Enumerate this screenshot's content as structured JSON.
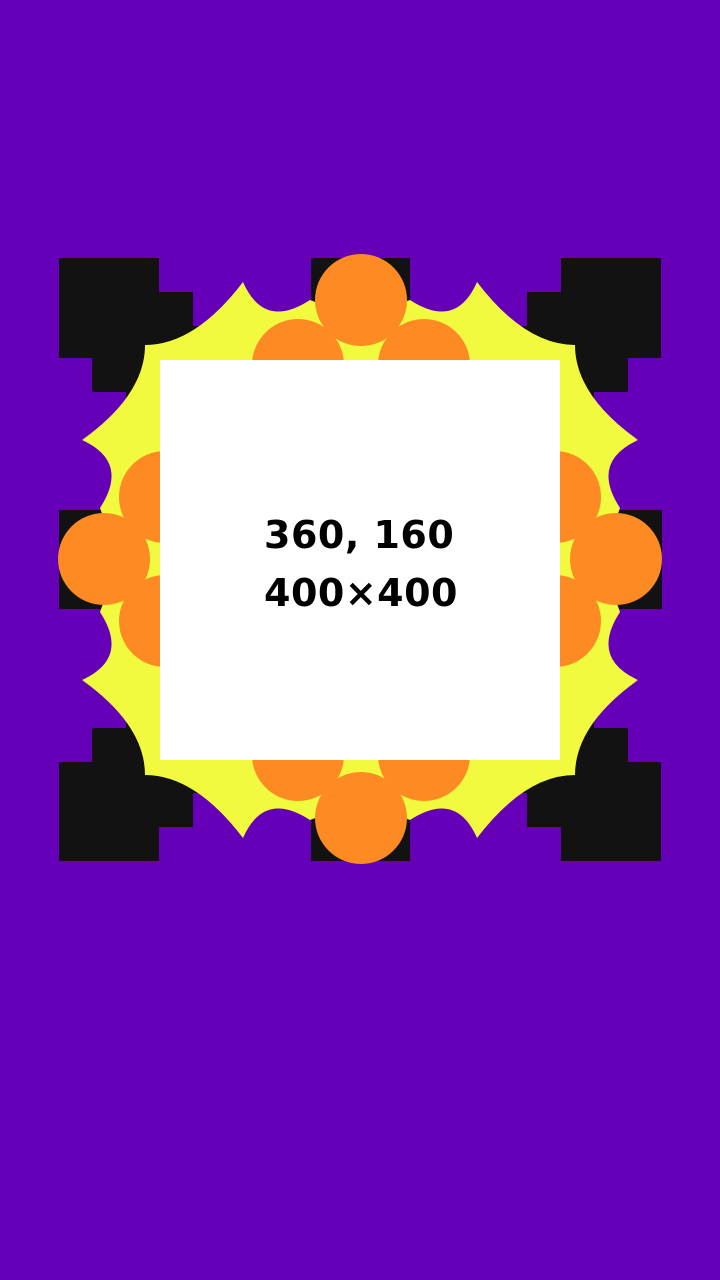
{
  "screen": {
    "background_color": "#6600b8"
  },
  "frame": {
    "corner_color": "#121212",
    "burst_color": "#f2fa3f",
    "scallop_color": "#fd8a22"
  },
  "card": {
    "background_color": "#ffffff",
    "position_label": "360, 160",
    "size_label": "400×400"
  }
}
